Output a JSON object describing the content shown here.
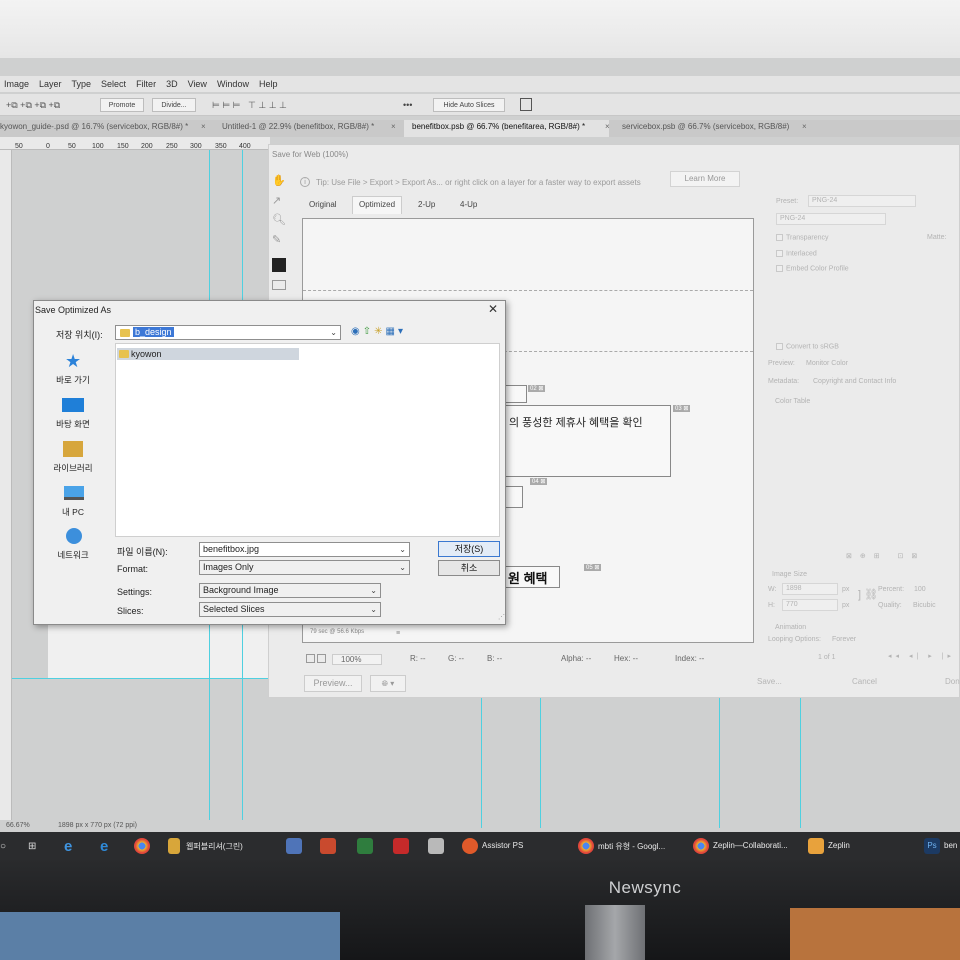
{
  "menu": [
    "Image",
    "Layer",
    "Type",
    "Select",
    "Filter",
    "3D",
    "View",
    "Window",
    "Help"
  ],
  "options": {
    "promote": "Promote",
    "divide": "Divide...",
    "more": "•••",
    "hide_auto": "Hide Auto Slices"
  },
  "doc_tabs": [
    "kyowon_guide-.psd @ 16.7% (servicebox, RGB/8#) *",
    "Untitled-1 @ 22.9% (benefitbox, RGB/8#) *",
    "benefitbox.psb @ 66.7% (benefitarea, RGB/8#) *",
    "servicebox.psb @ 66.7% (servicebox, RGB/8#)"
  ],
  "ruler_ticks": [
    "50",
    "0",
    "50",
    "100",
    "150",
    "200",
    "250",
    "300",
    "350",
    "400"
  ],
  "save_for_web": {
    "title": "Save for Web (100%)",
    "tip": "Tip: Use File > Export > Export As...  or right click on a layer for a faster way to export assets",
    "learn_more": "Learn More",
    "view_tabs": [
      "Original",
      "Optimized",
      "2-Up",
      "4-Up"
    ],
    "preview_text": {
      "line1": "의 풍성한 제휴사 혜택을 확인",
      "line2": "원 혜택"
    },
    "right": {
      "preset_label": "Preset:",
      "preset_value": "PNG-24",
      "format_value": "PNG-24",
      "transparency": "Transparency",
      "interlaced": "Interlaced",
      "embed": "Embed Color Profile",
      "matte": "Matte:",
      "convert": "Convert to sRGB",
      "preview_label": "Preview:",
      "preview_value": "Monitor Color",
      "metadata_label": "Metadata:",
      "metadata_value": "Copyright and Contact Info",
      "color_table": "Color Table",
      "image_size": "Image Size",
      "w_label": "W:",
      "w_value": "1898",
      "h_label": "H:",
      "h_value": "770",
      "px": "px",
      "percent_label": "Percent:",
      "percent_value": "100",
      "quality_label": "Quality:",
      "quality_value": "Bicubic",
      "animation": "Animation",
      "looping_label": "Looping Options:",
      "looping_value": "Forever",
      "frame": "1 of 1"
    },
    "status_info": "PNG-24\n79 sec @ 56.6 Kbps",
    "zoom": "100%",
    "r": "R: --",
    "g": "G: --",
    "b": "B: --",
    "alpha": "Alpha: --",
    "hex": "Hex: --",
    "index": "Index: --",
    "preview_btn": "Preview...",
    "save_btn": "Save...",
    "cancel_btn": "Cancel",
    "done_btn": "Done"
  },
  "dialog": {
    "title": "Save Optimized As",
    "save_in_label": "저장 위치(I):",
    "save_in_value": "b_design",
    "places": [
      "바로 가기",
      "바탕 화면",
      "라이브러리",
      "내 PC",
      "네트워크"
    ],
    "files": [
      "kyowon"
    ],
    "filename_label": "파일 이름(N):",
    "filename_value": "benefitbox.jpg",
    "format_label": "Format:",
    "format_value": "Images Only",
    "settings_label": "Settings:",
    "settings_value": "Background Image",
    "slices_label": "Slices:",
    "slices_value": "Selected Slices",
    "save_btn": "저장(S)",
    "cancel_btn": "취소"
  },
  "statusbar": {
    "zoom": "66.67%",
    "size": "1898 px x 770 px (72 ppi)"
  },
  "taskbar": [
    "웹퍼블리셔(그린)",
    "Assistor PS",
    "mbti 유형 - Googl...",
    "Zeplin—Collaborati...",
    "Zeplin",
    "ben"
  ],
  "brand": "Newsync"
}
